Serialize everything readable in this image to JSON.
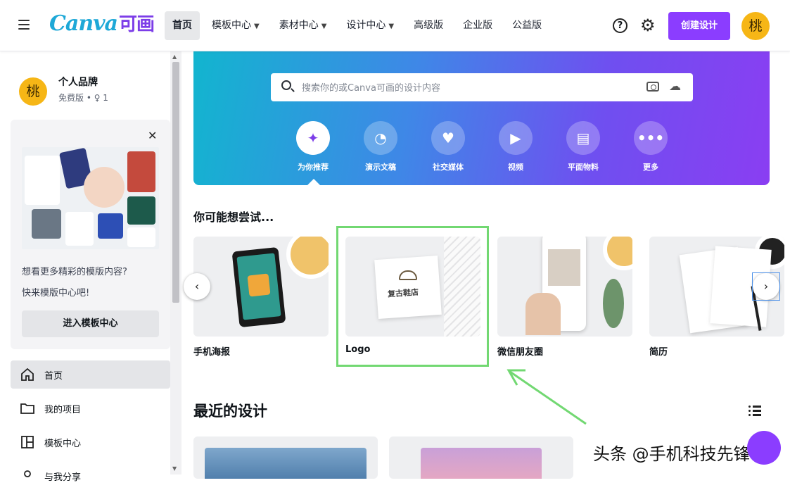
{
  "header": {
    "logo_text": "Canva",
    "logo_cn": "可画",
    "nav": [
      {
        "label": "首页",
        "active": true,
        "dropdown": false
      },
      {
        "label": "模板中心",
        "active": false,
        "dropdown": true
      },
      {
        "label": "素材中心",
        "active": false,
        "dropdown": true
      },
      {
        "label": "设计中心",
        "active": false,
        "dropdown": true
      },
      {
        "label": "高级版",
        "active": false,
        "dropdown": false
      },
      {
        "label": "企业版",
        "active": false,
        "dropdown": false
      },
      {
        "label": "公益版",
        "active": false,
        "dropdown": false
      }
    ],
    "help_glyph": "?",
    "create_button": "创建设计",
    "avatar_letter": "桃",
    "accent_color": "#8b3dff"
  },
  "sidebar": {
    "brand": {
      "avatar_letter": "桃",
      "name": "个人品牌",
      "plan": "免费版 • ♀ 1"
    },
    "promo": {
      "close_glyph": "✕",
      "text_line1": "想看更多精彩的模版内容?",
      "text_line2": "快来模版中心吧!",
      "button": "进入模板中心"
    },
    "nav": [
      {
        "label": "首页",
        "icon": "home-icon",
        "active": true
      },
      {
        "label": "我的项目",
        "icon": "folder-icon",
        "active": false
      },
      {
        "label": "模板中心",
        "icon": "template-icon",
        "active": false
      },
      {
        "label": "与我分享",
        "icon": "share-icon",
        "active": false
      }
    ]
  },
  "hero": {
    "search_placeholder": "搜索你的或Canva可画的设计内容",
    "categories": [
      {
        "label": "为你推荐",
        "icon": "sparkle-icon",
        "glyph": "✦",
        "selected": true
      },
      {
        "label": "演示文稿",
        "icon": "presentation-icon",
        "glyph": "◔",
        "selected": false
      },
      {
        "label": "社交媒体",
        "icon": "heart-icon",
        "glyph": "♥",
        "selected": false
      },
      {
        "label": "视频",
        "icon": "video-icon",
        "glyph": "▶",
        "selected": false
      },
      {
        "label": "平面物料",
        "icon": "printer-icon",
        "glyph": "▤",
        "selected": false
      },
      {
        "label": "更多",
        "icon": "more-icon",
        "glyph": "•••",
        "selected": false
      }
    ]
  },
  "suggestions": {
    "title": "你可能想尝试...",
    "items": [
      {
        "label": "手机海报"
      },
      {
        "label": "Logo",
        "thumb_text": "复古鞋店"
      },
      {
        "label": "微信朋友圈"
      },
      {
        "label": "简历"
      }
    ],
    "prev_glyph": "‹",
    "next_glyph": "›"
  },
  "recent": {
    "title": "最近的设计"
  },
  "watermark": "头条 @手机科技先锋"
}
